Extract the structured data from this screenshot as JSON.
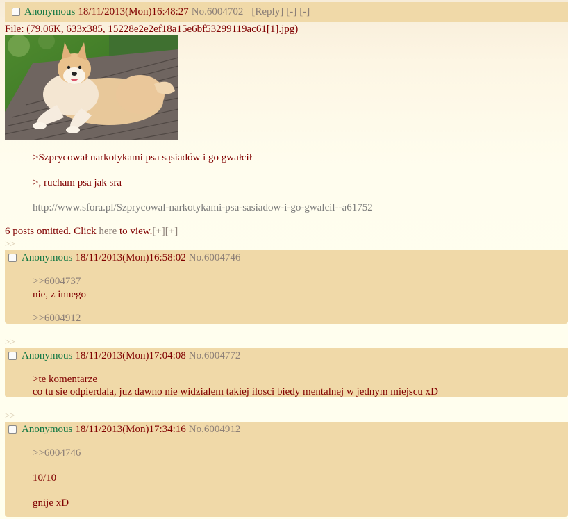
{
  "op": {
    "name": "Anonymous",
    "datetime": "18/11/2013(Mon)16:48:27",
    "post_no": "No.6004702",
    "reply_link": "[Reply]",
    "hide_link": "[-]",
    "collapse_link": "[-]",
    "file_info": "File: (79.06K, 633x385, 15228e2e2ef18a15e6bf53299119ac61[1].jpg)",
    "lines": [
      ">Szprycował narkotykami psa sąsiadów i go gwałcił",
      ">, rucham psa jak sra",
      "http://www.sfora.pl/Szprycowal-narkotykami-psa-sasiadow-i-go-gwalcil--a61752"
    ]
  },
  "omitted": {
    "text_before": "6 posts omitted. Click ",
    "here": "here",
    "text_after": " to view.",
    "expand1": "[+]",
    "expand2": "[+]"
  },
  "reply_marker": ">>",
  "replies": [
    {
      "name": "Anonymous",
      "datetime": "18/11/2013(Mon)16:58:02",
      "post_no": "No.6004746",
      "lines": [
        ">>6004737",
        "nie, z innego"
      ],
      "backlink": ">>6004912"
    },
    {
      "name": "Anonymous",
      "datetime": "18/11/2013(Mon)17:04:08",
      "post_no": "No.6004772",
      "lines": [
        ">te komentarze",
        "co tu sie odpierdala, juz dawno nie widzialem takiej ilosci biedy mentalnej w jednym miejscu xD"
      ]
    },
    {
      "name": "Anonymous",
      "datetime": "18/11/2013(Mon)17:34:16",
      "post_no": "No.6004912",
      "lines": [
        ">>6004746",
        "10/10",
        "gnije xD"
      ]
    }
  ],
  "colors": {
    "post_bg": "#f0d9a8",
    "name": "#117743",
    "text": "#800000",
    "muted": "#8c7f77"
  }
}
